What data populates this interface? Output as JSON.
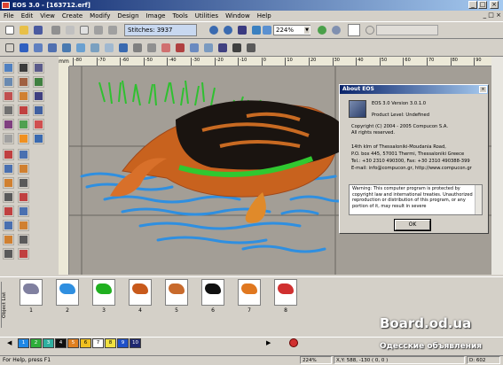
{
  "window": {
    "title": "EOS 3.0 - [163712.erf]",
    "min": "_",
    "max": "□",
    "close": "×"
  },
  "menu": [
    "File",
    "Edit",
    "View",
    "Create",
    "Modify",
    "Design",
    "Image",
    "Tools",
    "Utilities",
    "Window",
    "Help"
  ],
  "toolbar": {
    "stitches": "Stitches: 3937",
    "zoom": "224%"
  },
  "ruler": {
    "units": "mm",
    "ticks": [
      "-80",
      "-70",
      "-60",
      "-50",
      "-40",
      "-30",
      "-20",
      "-10",
      "0",
      "10",
      "20",
      "30",
      "40",
      "50",
      "60",
      "70",
      "80",
      "90"
    ]
  },
  "about": {
    "title": "About EOS",
    "close": "×",
    "version": "EOS 3.0 Version 3.0.1.0",
    "level": "Product Level:  Undefined",
    "copyright": "Copyright (C) 2004 - 2005 Compucon S.A.",
    "rights": "All rights reserved.",
    "addr1": "14th klm of Thessaloniki-Moudania Road,",
    "addr2": "P.O. box 445, 57001 Thermi, Thessaloniki Greece",
    "tel": "Tel.: +30 2310 490300, Fax: +30 2310 490388-399",
    "email": "E-mail: info@compucon.gr, http://www.compucon.gr",
    "warning": "Warning: This computer program is protected by copyright law and international treaties. Unauthorized reproduction or distribution of this program, or any portion of it, may result in severe",
    "ok": "OK"
  },
  "objects": {
    "label": "Object List",
    "items": [
      {
        "num": "1",
        "color": "#8080a0"
      },
      {
        "num": "2",
        "color": "#2f8fe0"
      },
      {
        "num": "3",
        "color": "#20b020"
      },
      {
        "num": "4",
        "color": "#c85a1c"
      },
      {
        "num": "5",
        "color": "#c86a2c"
      },
      {
        "num": "6",
        "color": "#101010"
      },
      {
        "num": "7",
        "color": "#e07820"
      },
      {
        "num": "8",
        "color": "#d03030"
      }
    ]
  },
  "palette": [
    {
      "num": "1",
      "color": "#1e88e5"
    },
    {
      "num": "2",
      "color": "#2fae3a"
    },
    {
      "num": "3",
      "color": "#2fb0a0"
    },
    {
      "num": "4",
      "color": "#101010"
    },
    {
      "num": "5",
      "color": "#e08020"
    },
    {
      "num": "6",
      "color": "#f0c020"
    },
    {
      "num": "7",
      "color": "#ffffff"
    },
    {
      "num": "8",
      "color": "#f0e040"
    },
    {
      "num": "9",
      "color": "#1e50c8"
    },
    {
      "num": "10",
      "color": "#1e2870"
    }
  ],
  "status": {
    "help": "For Help, press F1",
    "zoom": "224%",
    "coords": "X,Y: 588, -130  ( 0, 0 )",
    "d": "D: 602"
  },
  "watermark": {
    "line1": "Board.od.ua",
    "line2": "Одесские объявления"
  }
}
